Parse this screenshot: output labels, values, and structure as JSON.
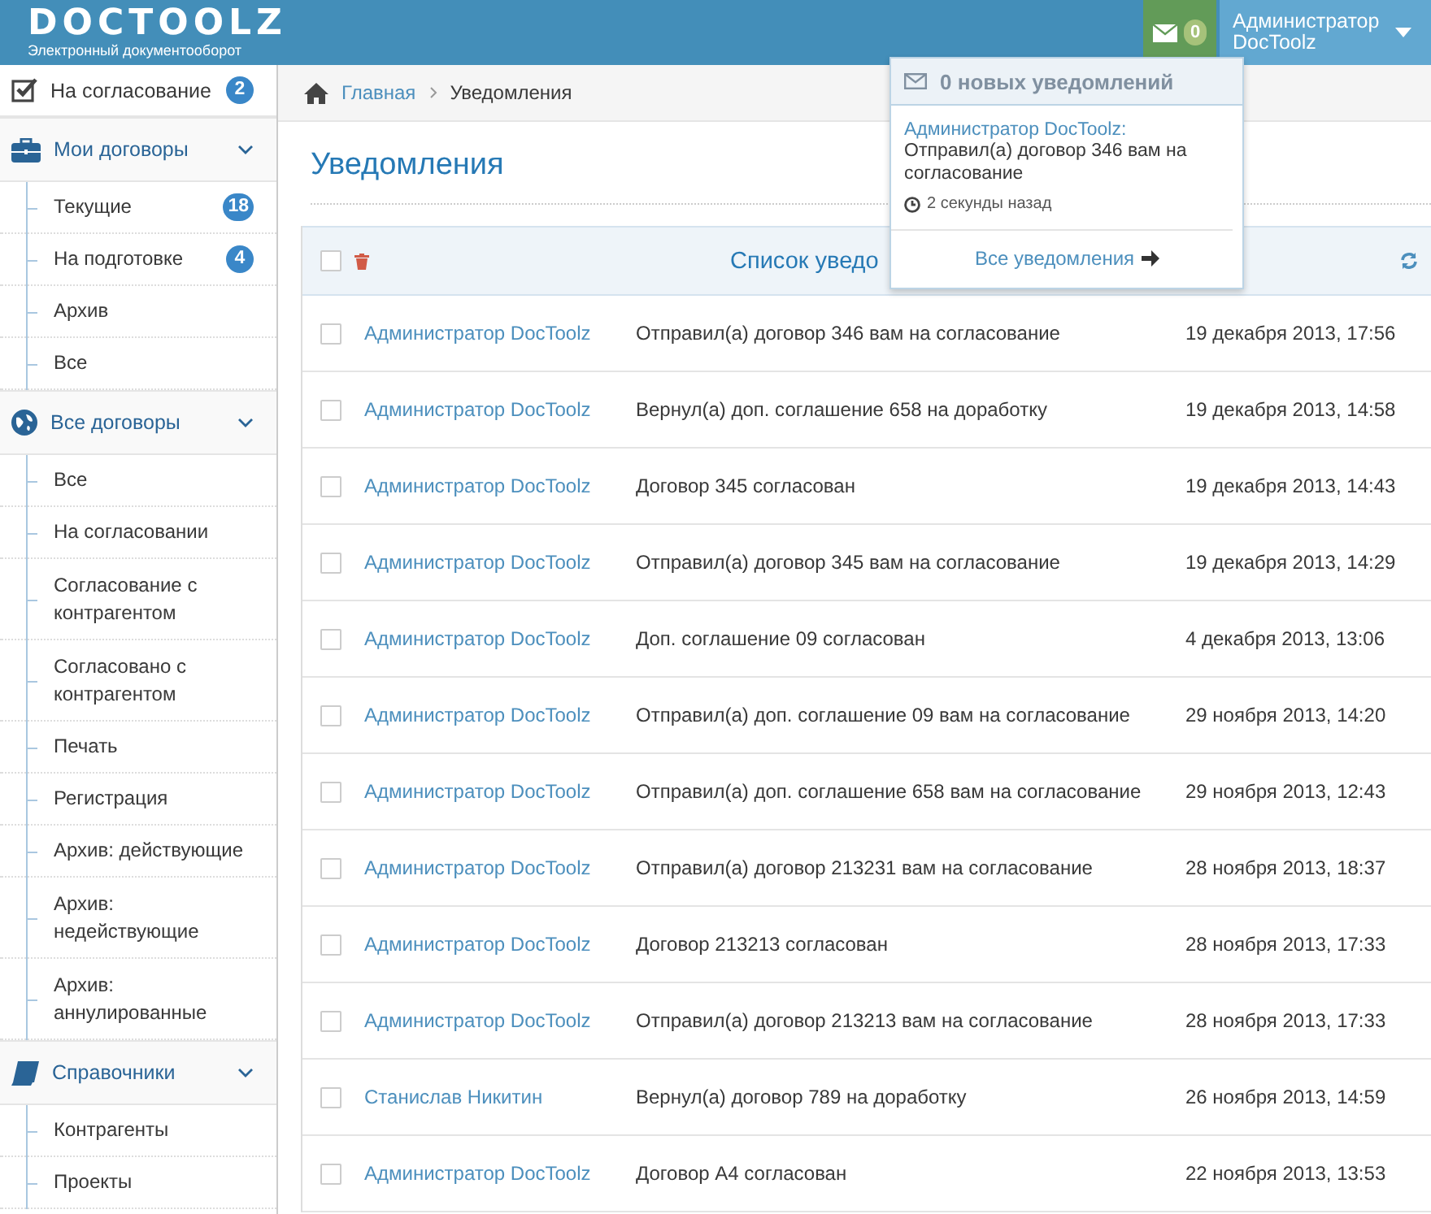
{
  "header": {
    "logo": "DOCTOOLZ",
    "tagline": "Электронный документооборот",
    "mail_count": "0",
    "user": "Администратор DocToolz"
  },
  "notifications_menu": {
    "title": "0 новых уведомлений",
    "items": [
      {
        "author": "Администратор DocToolz:",
        "text": "Отправил(а) договор 346 вам на согласование",
        "time": "2 секунды назад"
      }
    ],
    "footer": "Все уведомления"
  },
  "sidebar": {
    "items": [
      {
        "kind": "link",
        "label": "На согласование",
        "badge": "2"
      },
      {
        "kind": "group",
        "label": "Мои договоры",
        "expanded": true,
        "children": [
          {
            "label": "Текущие",
            "badge": "18"
          },
          {
            "label": "На подготовке",
            "badge": "4"
          },
          {
            "label": "Архив"
          },
          {
            "label": "Все"
          }
        ]
      },
      {
        "kind": "group",
        "label": "Все договоры",
        "expanded": true,
        "children": [
          {
            "label": "Все"
          },
          {
            "label": "На согласовании"
          },
          {
            "label": "Согласование с контрагентом"
          },
          {
            "label": "Согласовано с контрагентом"
          },
          {
            "label": "Печать"
          },
          {
            "label": "Регистрация"
          },
          {
            "label": "Архив: действующие"
          },
          {
            "label": "Архив: недействующие"
          },
          {
            "label": "Архив: аннулированные"
          }
        ]
      },
      {
        "kind": "group",
        "label": "Справочники",
        "expanded": true,
        "children": [
          {
            "label": "Контрагенты"
          },
          {
            "label": "Проекты"
          }
        ]
      }
    ]
  },
  "breadcrumb": [
    "Главная",
    "Уведомления"
  ],
  "page_title": "Уведомления",
  "table": {
    "title": "Список уведо",
    "all_checked": false,
    "rows": [
      {
        "checked": false,
        "sender": "Администратор DocToolz",
        "message": "Отправил(а) договор 346 вам на согласование",
        "date": "19 декабря 2013, 17:56"
      },
      {
        "checked": false,
        "sender": "Администратор DocToolz",
        "message": "Вернул(а) доп. соглашение 658 на доработку",
        "date": "19 декабря 2013, 14:58"
      },
      {
        "checked": false,
        "sender": "Администратор DocToolz",
        "message": "Договор 345 согласован",
        "date": "19 декабря 2013, 14:43"
      },
      {
        "checked": false,
        "sender": "Администратор DocToolz",
        "message": "Отправил(а) договор 345 вам на согласование",
        "date": "19 декабря 2013, 14:29"
      },
      {
        "checked": false,
        "sender": "Администратор DocToolz",
        "message": "Доп. соглашение 09 согласован",
        "date": "4 декабря 2013, 13:06"
      },
      {
        "checked": false,
        "sender": "Администратор DocToolz",
        "message": "Отправил(а) доп. соглашение 09 вам на согласование",
        "date": "29 ноября 2013, 14:20"
      },
      {
        "checked": false,
        "sender": "Администратор DocToolz",
        "message": "Отправил(а) доп. соглашение 658 вам на согласование",
        "date": "29 ноября 2013, 12:43"
      },
      {
        "checked": false,
        "sender": "Администратор DocToolz",
        "message": "Отправил(а) договор 213231 вам на согласование",
        "date": "28 ноября 2013, 18:37"
      },
      {
        "checked": false,
        "sender": "Администратор DocToolz",
        "message": "Договор 213213 согласован",
        "date": "28 ноября 2013, 17:33"
      },
      {
        "checked": false,
        "sender": "Администратор DocToolz",
        "message": "Отправил(а) договор 213213 вам на согласование",
        "date": "28 ноября 2013, 17:33"
      },
      {
        "checked": false,
        "sender": "Станислав Никитин",
        "message": "Вернул(а) договор 789 на доработку",
        "date": "26 ноября 2013, 14:59"
      },
      {
        "checked": false,
        "sender": "Администратор DocToolz",
        "message": "Договор А4 согласован",
        "date": "22 ноября 2013, 13:53"
      }
    ]
  }
}
